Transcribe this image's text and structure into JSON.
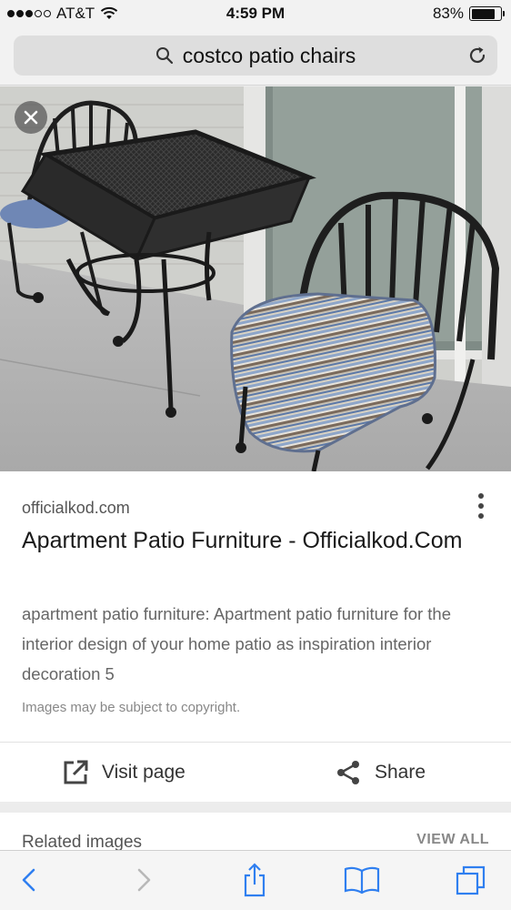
{
  "status_bar": {
    "carrier": "AT&T",
    "time": "4:59 PM",
    "battery": "83%",
    "battery_level": 0.83,
    "signal_bars_filled": 3,
    "signal_bars_total": 5
  },
  "url_bar": {
    "query": "costco patio chairs",
    "search_icon": "search-icon",
    "reload_icon": "reload-icon"
  },
  "result": {
    "source": "officialkod.com",
    "title": "Apartment Patio Furniture - Officialkod.Com",
    "description": "apartment patio furniture: Apartment patio furniture for the interior design of your home patio as inspiration interior decoration 5",
    "copyright": "Images may be subject to copyright.",
    "close_icon": "close-icon",
    "more_icon": "more-vert-icon"
  },
  "actions": {
    "visit_label": "Visit page",
    "share_label": "Share",
    "visit_icon": "open-in-new-icon",
    "share_icon": "share-icon"
  },
  "related": {
    "title": "Related images",
    "view_all": "VIEW ALL"
  },
  "toolbar": {
    "icons": [
      "back-icon",
      "forward-icon",
      "share-icon",
      "bookmarks-icon",
      "tabs-icon"
    ]
  },
  "colors": {
    "accent": "#2f7ff0"
  }
}
